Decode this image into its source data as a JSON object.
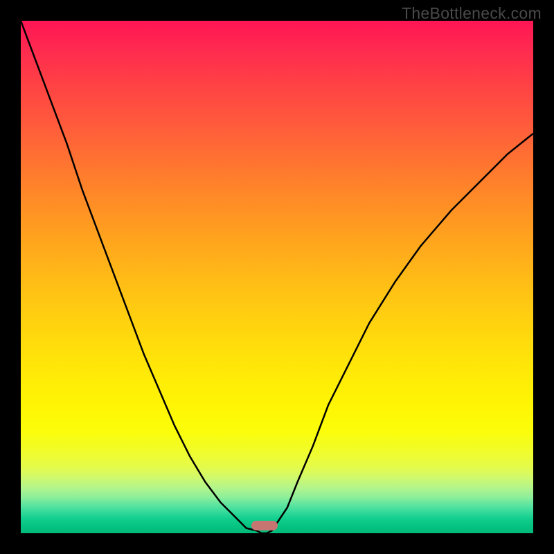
{
  "watermark": "TheBottleneck.com",
  "chart_data": {
    "type": "line",
    "title": "",
    "xlabel": "",
    "ylabel": "",
    "x": [
      0.0,
      0.03,
      0.06,
      0.09,
      0.12,
      0.15,
      0.18,
      0.21,
      0.24,
      0.27,
      0.3,
      0.33,
      0.36,
      0.39,
      0.42,
      0.44,
      0.46,
      0.47,
      0.48,
      0.49,
      0.5,
      0.52,
      0.54,
      0.57,
      0.6,
      0.64,
      0.68,
      0.73,
      0.78,
      0.84,
      0.9,
      0.95,
      1.0
    ],
    "values": [
      1.0,
      0.92,
      0.84,
      0.76,
      0.67,
      0.59,
      0.51,
      0.43,
      0.35,
      0.28,
      0.21,
      0.15,
      0.1,
      0.06,
      0.03,
      0.01,
      0.005,
      0.0,
      0.0,
      0.005,
      0.02,
      0.05,
      0.1,
      0.17,
      0.25,
      0.33,
      0.41,
      0.49,
      0.56,
      0.63,
      0.69,
      0.74,
      0.78
    ],
    "xlim": [
      0,
      1
    ],
    "ylim": [
      0,
      1
    ],
    "marker_position": {
      "x": 0.475,
      "y": 0.985
    },
    "annotations": [
      "V-shaped bottleneck curve with gradient background from red (high) through yellow to green (low)"
    ]
  },
  "colors": {
    "background": "#000000",
    "curve": "#000000",
    "marker": "#c77570",
    "watermark_text": "#4a4a4a"
  }
}
